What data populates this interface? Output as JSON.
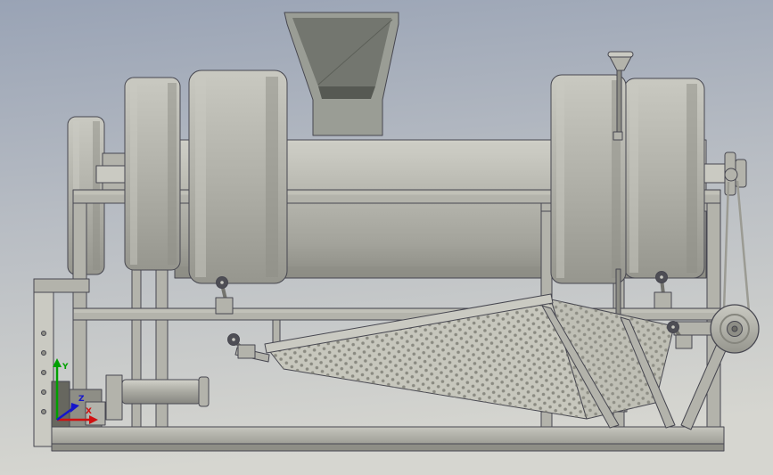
{
  "axis_triad": {
    "x_label": "X",
    "y_label": "Y",
    "z_label": "Z",
    "x_color": "#d01010",
    "y_color": "#00a000",
    "z_color": "#1515cc"
  },
  "colors": {
    "bg_top": "#99a3b5",
    "bg_mid": "#b7bcc3",
    "bg_bottom": "#d6d6d0",
    "steel": "#b3b3ab",
    "steel_light": "#cacac2",
    "steel_dark": "#8e8e86",
    "drum_top": "#d0d0c8",
    "drum_mid": "#bcbcb4",
    "drum_low": "#a3a39b",
    "drum_bottom": "#8b8b83",
    "disc_top": "#c9c9c1",
    "disc_mid": "#b1b1a9",
    "disc_bottom": "#96968e",
    "cyl_top": "#d2d2ca",
    "cyl_mid": "#a9a9a1",
    "cyl_bottom": "#868680",
    "base_top": "#c6c6be",
    "base_bottom": "#9c9c94",
    "hopper": "#9a9d95",
    "hopper_inner": "#73766f",
    "hopper_deep": "#565953",
    "screen_fill": "#c7c7bd",
    "screen_fill2": "#bfbfb5",
    "perf_dot": "#8a8a81",
    "motor_dark": "#67675f",
    "knob": "#4e4e55",
    "belt": "#9b9b93",
    "pin": "#6b6b64"
  }
}
